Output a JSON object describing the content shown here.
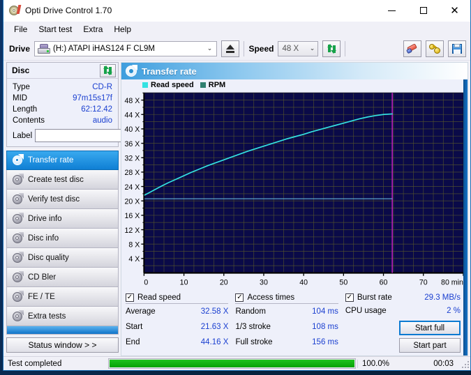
{
  "window": {
    "title": "Opti Drive Control 1.70",
    "icon": "disc-icon",
    "controls": {
      "minimize": "minimize-icon",
      "maximize": "maximize-icon",
      "close": "close-icon"
    }
  },
  "menu": {
    "items": [
      "File",
      "Start test",
      "Extra",
      "Help"
    ]
  },
  "toolbar": {
    "drive_label": "Drive",
    "drive_value": "(H:)  ATAPI iHAS124   F CL9M",
    "drive_icon": "optical-drive-icon",
    "eject_icon": "eject-icon",
    "speed_label": "Speed",
    "speed_value": "48 X",
    "refresh_icon": "refresh-icon",
    "erase_icon": "eraser-icon",
    "tools_icon": "bug-icon",
    "save_icon": "floppy-save-icon"
  },
  "disc": {
    "title": "Disc",
    "refresh_icon": "refresh-icon",
    "rows": [
      {
        "key": "Type",
        "value": "CD-R"
      },
      {
        "key": "MID",
        "value": "97m15s17f"
      },
      {
        "key": "Length",
        "value": "62:12.42"
      },
      {
        "key": "Contents",
        "value": "audio"
      }
    ],
    "label_key": "Label",
    "label_value": "",
    "label_placeholder": "",
    "label_button_icon": "cd-icon"
  },
  "sidebar": {
    "items": [
      {
        "label": "Transfer rate",
        "icon": "disc-test-icon",
        "active": true
      },
      {
        "label": "Create test disc",
        "icon": "disc-test-icon",
        "active": false
      },
      {
        "label": "Verify test disc",
        "icon": "disc-test-icon",
        "active": false
      },
      {
        "label": "Drive info",
        "icon": "disc-test-icon",
        "active": false
      },
      {
        "label": "Disc info",
        "icon": "disc-test-icon",
        "active": false
      },
      {
        "label": "Disc quality",
        "icon": "disc-test-icon",
        "active": false
      },
      {
        "label": "CD Bler",
        "icon": "disc-test-icon",
        "active": false
      },
      {
        "label": "FE / TE",
        "icon": "disc-test-icon",
        "active": false
      },
      {
        "label": "Extra tests",
        "icon": "disc-test-icon",
        "active": false
      }
    ],
    "status_button": "Status window > >"
  },
  "panel": {
    "title": "Transfer rate",
    "icon": "disc-test-icon"
  },
  "chart_data": {
    "type": "line",
    "title": "Transfer rate",
    "xlabel": "min",
    "ylabel": "",
    "xlim": [
      0,
      80
    ],
    "ylim": [
      0,
      50
    ],
    "xticks": [
      0,
      10,
      20,
      30,
      40,
      50,
      60,
      70,
      80
    ],
    "xticklabels": [
      "0",
      "10",
      "20",
      "30",
      "40",
      "50",
      "60",
      "70",
      "80 min"
    ],
    "yticks": [
      4,
      8,
      12,
      16,
      20,
      24,
      28,
      32,
      36,
      40,
      44,
      48
    ],
    "yticklabels": [
      "4 X",
      "8 X",
      "12 X",
      "16 X",
      "20 X",
      "24 X",
      "28 X",
      "32 X",
      "36 X",
      "40 X",
      "44 X",
      "48 X"
    ],
    "grid": true,
    "background": "#0a0a48",
    "gridcolor": "#55552c",
    "legend_position": "top-left",
    "legend": [
      {
        "name": "Read speed",
        "color": "#34e2e2"
      },
      {
        "name": "RPM",
        "color": "#2f7f6f"
      }
    ],
    "markers": [
      {
        "name": "disc-end-marker",
        "x": 62.2,
        "color": "#c81ec8"
      }
    ],
    "series": [
      {
        "name": "Read speed",
        "color": "#34e2e2",
        "x": [
          0.2,
          2,
          4,
          6,
          8,
          10,
          12,
          14,
          16,
          18,
          20,
          22,
          24,
          26,
          28,
          30,
          32,
          34,
          36,
          38,
          40,
          42,
          44,
          46,
          48,
          50,
          52,
          54,
          56,
          58,
          60,
          62.2
        ],
        "y": [
          21.63,
          22.7,
          23.9,
          25.0,
          26.0,
          27.0,
          28.0,
          28.9,
          29.8,
          30.6,
          31.4,
          32.2,
          33.0,
          33.8,
          34.5,
          35.2,
          35.9,
          36.6,
          37.3,
          37.9,
          38.5,
          39.2,
          39.8,
          40.4,
          41.0,
          41.6,
          42.2,
          42.8,
          43.3,
          43.7,
          44.0,
          44.16
        ]
      },
      {
        "name": "RPM",
        "color": "#6fc8e8",
        "x": [
          0.2,
          62.2
        ],
        "y": [
          20.6,
          20.6
        ]
      }
    ]
  },
  "stats": {
    "read_speed": {
      "checked": true,
      "title": "Read speed",
      "rows": [
        {
          "key": "Average",
          "value": "32.58 X"
        },
        {
          "key": "Start",
          "value": "21.63 X"
        },
        {
          "key": "End",
          "value": "44.16 X"
        }
      ]
    },
    "access_times": {
      "checked": true,
      "title": "Access times",
      "rows": [
        {
          "key": "Random",
          "value": "104 ms"
        },
        {
          "key": "1/3 stroke",
          "value": "108 ms"
        },
        {
          "key": "Full stroke",
          "value": "156 ms"
        }
      ]
    },
    "burst": {
      "checked": true,
      "title": "Burst rate",
      "value": "29.3 MB/s",
      "cpu_key": "CPU usage",
      "cpu_value": "2 %",
      "start_full": "Start full",
      "start_part": "Start part"
    }
  },
  "statusbar": {
    "text": "Test completed",
    "progress": 100,
    "percent": "100.0%",
    "time": "00:03"
  }
}
